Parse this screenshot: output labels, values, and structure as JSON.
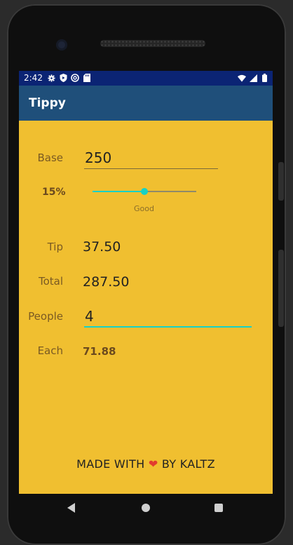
{
  "status": {
    "time": "2:42"
  },
  "app": {
    "title": "Tippy"
  },
  "form": {
    "base_label": "Base",
    "base_value": "250",
    "tip_percent": "15%",
    "tip_fraction": 0.5,
    "tip_quality": "Good",
    "tip_label": "Tip",
    "tip_value": "37.50",
    "total_label": "Total",
    "total_value": "287.50",
    "people_label": "People",
    "people_value": "4",
    "each_label": "Each",
    "each_value": "71.88"
  },
  "footer": {
    "before": "MADE WITH",
    "heart": "❤",
    "after": "BY KALTZ"
  },
  "colors": {
    "accent": "#17d1c6",
    "background": "#f0bf30",
    "appbar": "#1f4f7a",
    "statusbar": "#0b2474"
  },
  "icons": [
    "settings-icon",
    "shield-icon",
    "at-icon",
    "sd-card-icon",
    "wifi-icon",
    "signal-icon",
    "battery-icon",
    "back-icon",
    "home-icon",
    "recents-icon"
  ]
}
